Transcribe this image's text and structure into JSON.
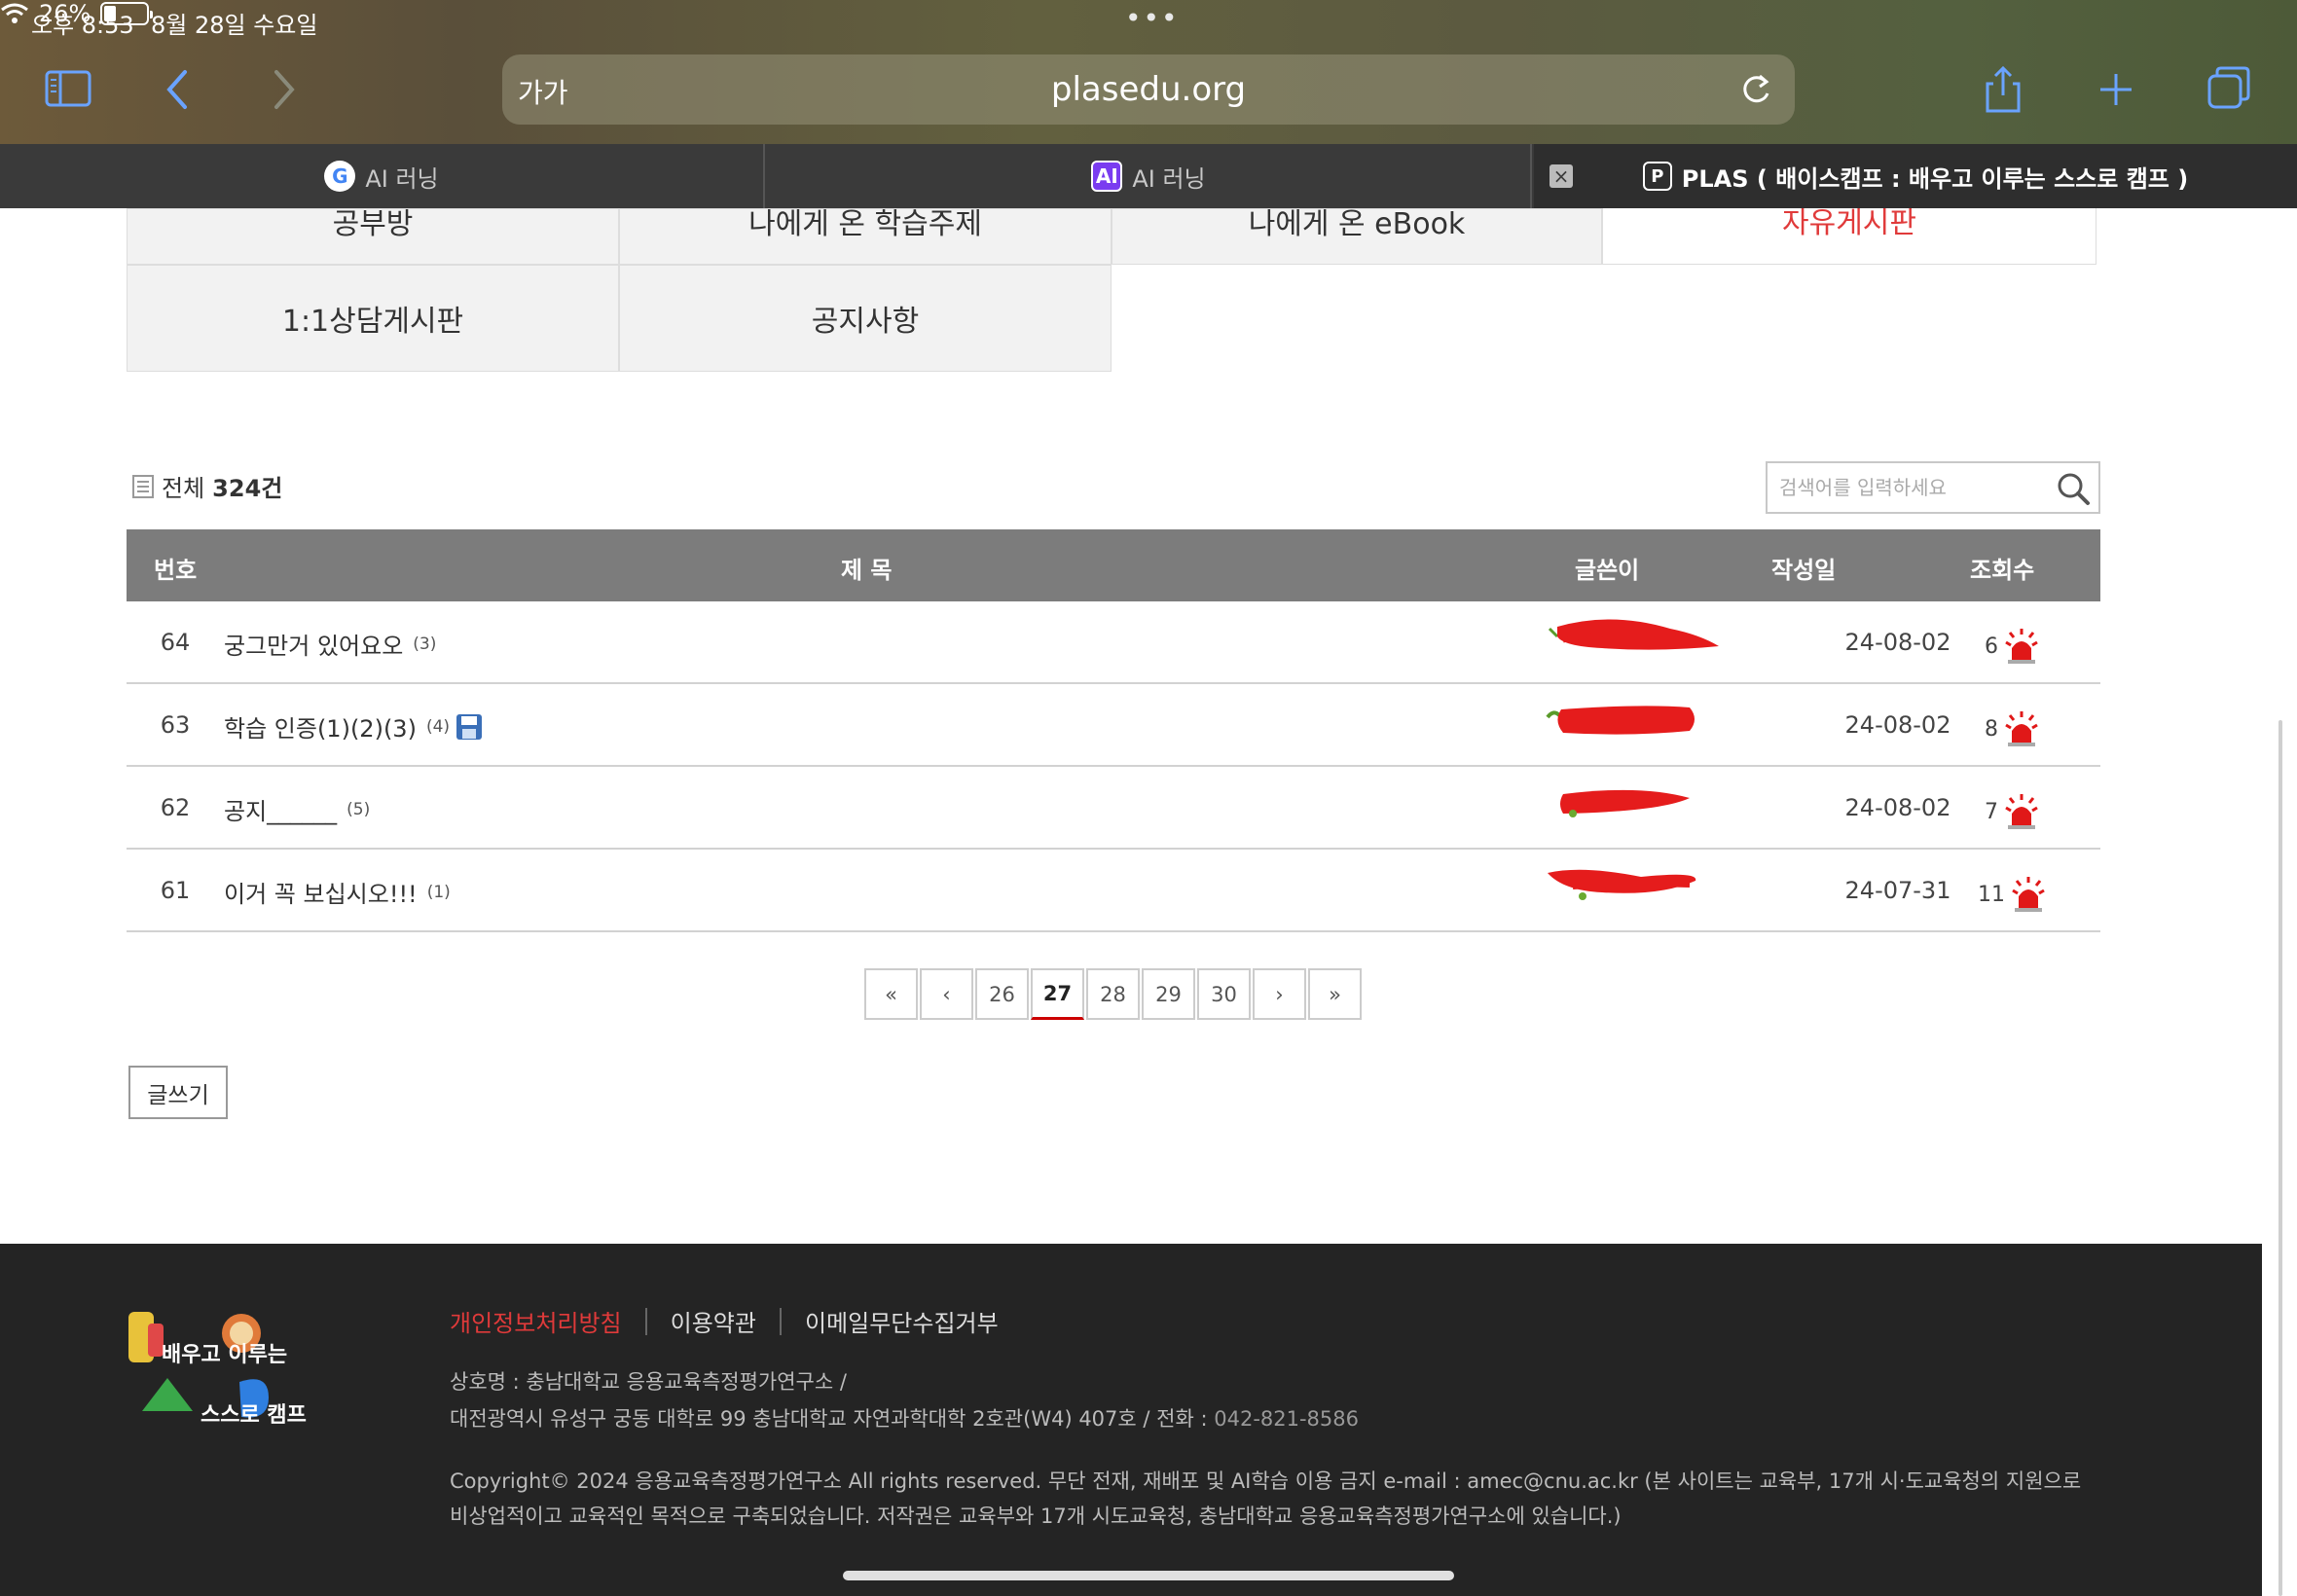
{
  "status": {
    "time": "오후 8:53",
    "date": "8월 28일 수요일",
    "dots": "•••",
    "battery": "26%"
  },
  "browser": {
    "aa": "가가",
    "host": "plasedu.org",
    "tabs": [
      {
        "label": "AI 러닝",
        "badge": "G"
      },
      {
        "label": "AI 러닝",
        "badge": "AI"
      },
      {
        "label": "PLAS ( 배이스캠프 : 배우고 이루는 스스로 캠프 )",
        "badge": "P"
      }
    ],
    "tab_close": "×"
  },
  "menu": {
    "row1": [
      "공부방",
      "나에게 온 학습주제",
      "나에게 온 eBook",
      "자유게시판"
    ],
    "row2": [
      "1:1상담게시판",
      "공지사항"
    ]
  },
  "board": {
    "total_label": "전체",
    "total_count": "324건",
    "search_placeholder": "검색어를 입력하세요",
    "headers": {
      "num": "번호",
      "title": "제 목",
      "author": "글쓴이",
      "date": "작성일",
      "views": "조회수"
    },
    "rows": [
      {
        "num": "64",
        "title": "궁그만거 있어요오",
        "comments": "(3)",
        "date": "24-08-02",
        "views": "6",
        "attachment": false
      },
      {
        "num": "63",
        "title": "학습 인증(1)(2)(3)",
        "comments": "(4)",
        "date": "24-08-02",
        "views": "8",
        "attachment": true
      },
      {
        "num": "62",
        "title": "공지______",
        "comments": "(5)",
        "date": "24-08-02",
        "views": "7",
        "attachment": false
      },
      {
        "num": "61",
        "title": "이거 꼭 보십시오!!!",
        "comments": "(1)",
        "date": "24-07-31",
        "views": "11",
        "attachment": false
      }
    ],
    "write_button": "글쓰기"
  },
  "pagination": {
    "first": "«",
    "prev": "‹",
    "pages": [
      "26",
      "27",
      "28",
      "29",
      "30"
    ],
    "current": "27",
    "next": "›",
    "last": "»"
  },
  "footer": {
    "links": [
      "개인정보처리방침",
      "이용약관",
      "이메일무단수집거부"
    ],
    "company": "상호명 : 충남대학교 응용교육측정평가연구소 /",
    "address": "대전광역시 유성구 궁동 대학로 99 충남대학교 자연과학대학 2호관(W4) 407호 / 전화 :",
    "phone": "042-821-8586",
    "copyright1": "Copyright© 2024 응용교육측정평가연구소 All rights reserved. 무단 전재, 재배포 및 AI학습 이용 금지 e-mail : amec@cnu.ac.kr (본 사이트는 교육부, 17개 시·도교육청의 지원으로",
    "copyright2": "비상업적이고 교육적인 목적으로 구축되었습니다. 저작권은 교육부와 17개 시도교육청, 충남대학교 응용교육측정평가연구소에 있습니다.)",
    "logo_text_1": "배우고 이루는",
    "logo_text_2": "스스로 캠프"
  },
  "colors": {
    "accent_red": "#e03a3a",
    "header_gray": "#7c7c7c",
    "footer_bg": "#242424"
  }
}
